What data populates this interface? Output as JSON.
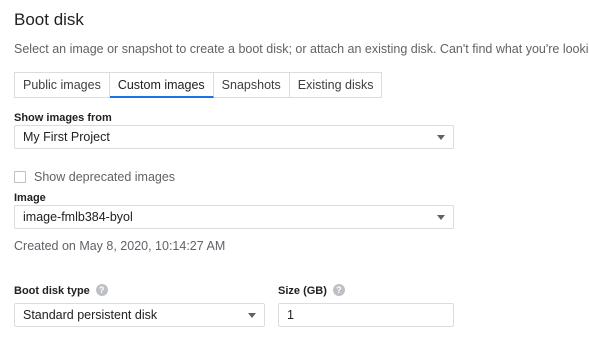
{
  "section": {
    "title": "Boot disk",
    "description": "Select an image or snapshot to create a boot disk; or attach an existing disk. Can't find what you're looking fo"
  },
  "tabs": [
    {
      "label": "Public images",
      "active": false
    },
    {
      "label": "Custom images",
      "active": true
    },
    {
      "label": "Snapshots",
      "active": false
    },
    {
      "label": "Existing disks",
      "active": false
    }
  ],
  "show_images_from": {
    "label": "Show images from",
    "value": "My First Project"
  },
  "deprecated": {
    "label": "Show deprecated images",
    "checked": false
  },
  "image": {
    "label": "Image",
    "value": "image-fmlb384-byol",
    "created": "Created on May 8, 2020, 10:14:27 AM"
  },
  "boot_disk_type": {
    "label": "Boot disk type",
    "value": "Standard persistent disk"
  },
  "size": {
    "label": "Size (GB)",
    "value": "1"
  },
  "colors": {
    "accent": "#1a73e8",
    "border": "#dadce0",
    "muted_text": "#5f6368"
  }
}
